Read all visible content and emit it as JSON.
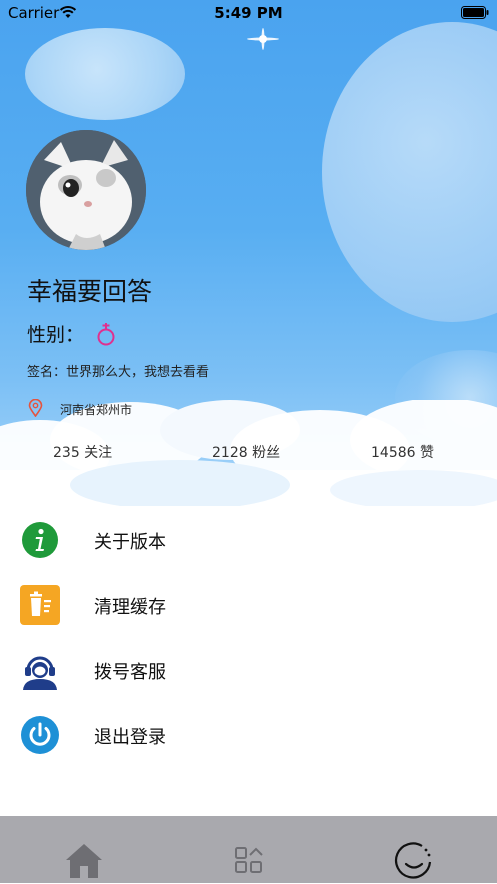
{
  "status_bar": {
    "carrier": "Carrier",
    "time": "5:49 PM"
  },
  "profile": {
    "username": "幸福要回答",
    "gender_label": "性别：",
    "gender_icon": "female-symbol-icon",
    "signature": "签名：世界那么大，我想去看看",
    "location": "河南省郑州市"
  },
  "stats": {
    "follow": "235 关注",
    "fans": "2128 粉丝",
    "likes": "14586 赞"
  },
  "menu": {
    "items": [
      {
        "label": "关于版本",
        "icon": "info-icon",
        "color": "#1f9a3a"
      },
      {
        "label": "清理缓存",
        "icon": "trash-icon",
        "color": "#f5a623"
      },
      {
        "label": "拨号客服",
        "icon": "customer-service-icon",
        "color": "#1f3d8a"
      },
      {
        "label": "退出登录",
        "icon": "power-icon",
        "color": "#1e90d6"
      }
    ]
  },
  "tab_bar": {
    "tabs": [
      {
        "icon": "home-icon"
      },
      {
        "icon": "category-icon"
      },
      {
        "icon": "profile-tab-icon",
        "selected": true
      }
    ]
  },
  "colors": {
    "sky": "#58aef2",
    "tab_bar": "#a9a9ae"
  }
}
